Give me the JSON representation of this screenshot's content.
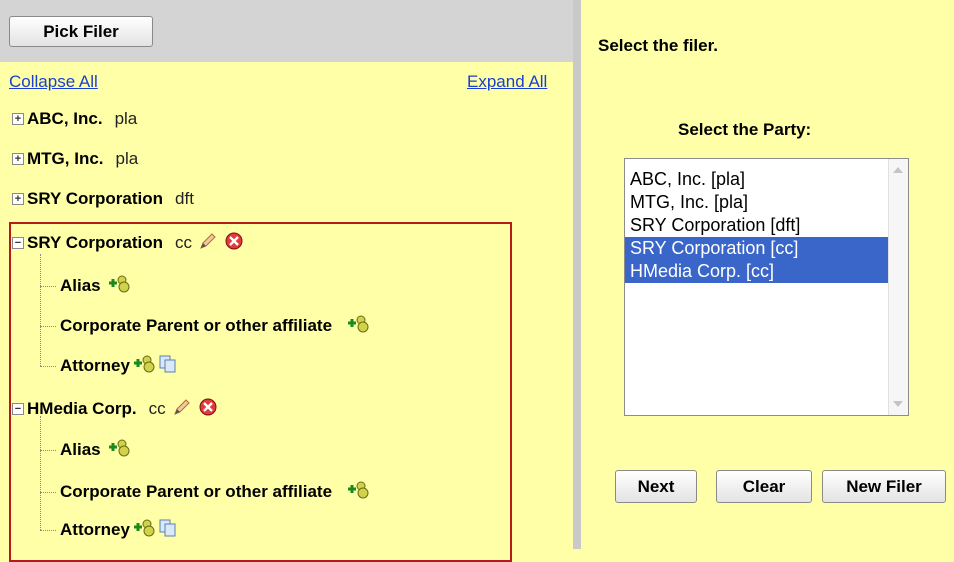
{
  "left_panel": {
    "pick_filer_label": "Pick Filer",
    "collapse_all_label": "Collapse All",
    "expand_all_label": "Expand All",
    "collapsed_parties": [
      {
        "name": "ABC, Inc.",
        "role": "pla"
      },
      {
        "name": "MTG, Inc.",
        "role": "pla"
      },
      {
        "name": "SRY Corporation",
        "role": "dft"
      }
    ],
    "expanded_parties": [
      {
        "name": "SRY Corporation",
        "role": "cc",
        "children": [
          "Alias",
          "Corporate Parent or other affiliate",
          "Attorney"
        ]
      },
      {
        "name": "HMedia Corp.",
        "role": "cc",
        "children": [
          "Alias",
          "Corporate Parent or other affiliate",
          "Attorney"
        ]
      }
    ]
  },
  "right_panel": {
    "instruction": "Select the filer.",
    "party_label": "Select the Party:",
    "party_options": [
      {
        "label": "ABC, Inc. [pla]",
        "selected": false
      },
      {
        "label": "MTG, Inc. [pla]",
        "selected": false
      },
      {
        "label": "SRY Corporation [dft]",
        "selected": false
      },
      {
        "label": "SRY Corporation [cc]",
        "selected": true
      },
      {
        "label": "HMedia Corp. [cc]",
        "selected": true
      }
    ],
    "next_label": "Next",
    "clear_label": "Clear",
    "new_filer_label": "New Filer"
  },
  "colors": {
    "panel_bg": "#FFFFA8",
    "header_gray": "#D4D4D4",
    "link_blue": "#1a3fd0",
    "selection_blue": "#3A66C9",
    "highlight_border": "#b51b1b"
  }
}
